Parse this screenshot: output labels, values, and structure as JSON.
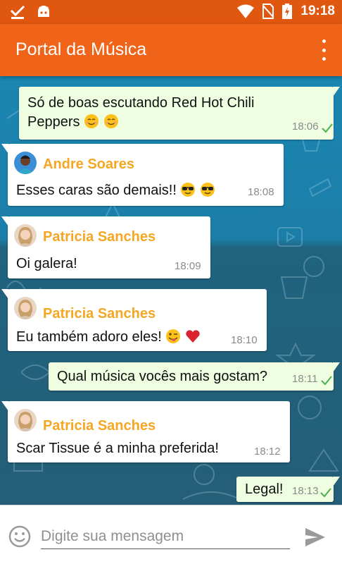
{
  "status_bar": {
    "time": "19:18",
    "icons": [
      "check-download-icon",
      "android-icon",
      "wifi-icon",
      "no-sim-icon",
      "battery-charging-icon"
    ]
  },
  "app_bar": {
    "title": "Portal da Música",
    "menu_icon": "overflow-menu-icon"
  },
  "messages": [
    {
      "direction": "outgoing",
      "text": "Só de boas escutando Red Hot Chili Peppers",
      "line1": "Só de boas escutando Red Hot Chili",
      "line2": "Peppers",
      "emojis": [
        "smiling-face",
        "smiling-face"
      ],
      "time": "18:06",
      "status": "delivered"
    },
    {
      "direction": "incoming",
      "sender": "Andre Soares",
      "text": "Esses caras são demais!!",
      "emojis": [
        "sunglasses-face",
        "sunglasses-face"
      ],
      "time": "18:08"
    },
    {
      "direction": "incoming",
      "sender": "Patricia Sanches",
      "text": "Oi galera!",
      "time": "18:09"
    },
    {
      "direction": "incoming",
      "sender": "Patricia Sanches",
      "text": "Eu também adoro eles!",
      "emojis": [
        "winking-tongue-face",
        "red-heart"
      ],
      "time": "18:10"
    },
    {
      "direction": "outgoing",
      "text": "Qual música vocês mais gostam?",
      "time": "18:11",
      "status": "delivered"
    },
    {
      "direction": "incoming",
      "sender": "Patricia Sanches",
      "text": "Scar Tissue é a minha preferida!",
      "time": "18:12"
    },
    {
      "direction": "outgoing",
      "text": "Legal!",
      "time": "18:13",
      "status": "delivered"
    }
  ],
  "input": {
    "placeholder": "Digite sua mensagem",
    "value": "",
    "emoji_icon": "emoji-icon",
    "send_icon": "send-icon"
  },
  "colors": {
    "status_bar": "#e0570f",
    "app_bar": "#f06419",
    "sender_name": "#f5a623",
    "outgoing_bubble": "#effee1",
    "check": "#4caf50"
  }
}
